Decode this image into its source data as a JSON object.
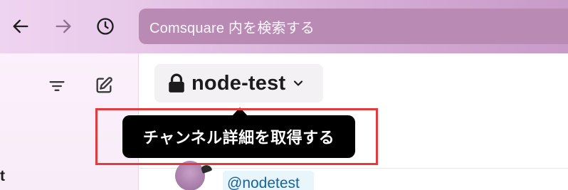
{
  "search": {
    "placeholder": "Comsquare 内を検索する"
  },
  "sidebar": {
    "fragment_text": "t"
  },
  "channel": {
    "name": "node-test"
  },
  "tooltip": {
    "text": "チャンネル詳細を取得する"
  },
  "message": {
    "mention": "@nodetest"
  },
  "colors": {
    "topbar": "#d9b3da",
    "search_bg": "#b98ab4",
    "tooltip_bg": "#000000",
    "highlight_border": "#e33b3b",
    "mention_text": "#1264a3"
  }
}
